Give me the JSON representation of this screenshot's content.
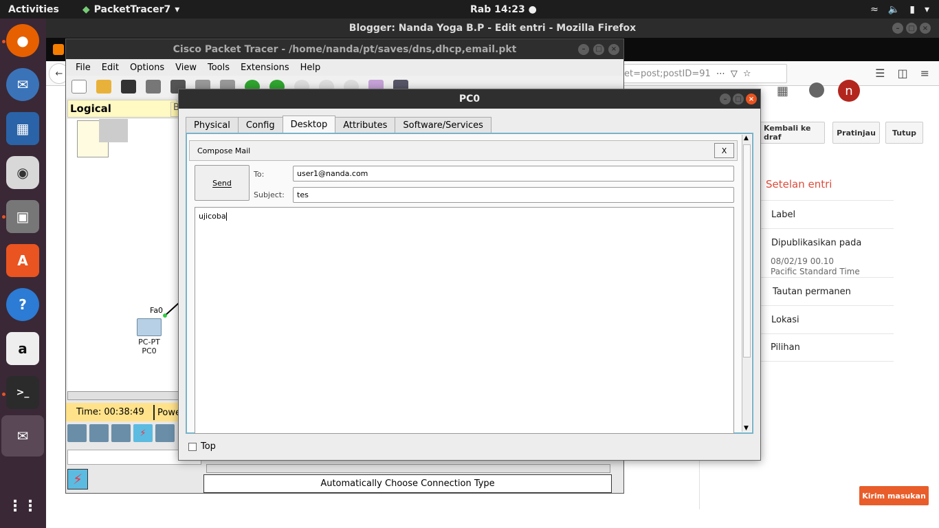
{
  "topbar": {
    "activities": "Activities",
    "app_name": "PacketTracer7",
    "clock": "Rab 14:23"
  },
  "dock": {
    "items": [
      "firefox-icon",
      "thunderbird-icon",
      "libreoffice-impress-icon",
      "rhythmbox-icon",
      "files-icon",
      "ubuntu-software-icon",
      "help-icon",
      "amazon-icon",
      "terminal-icon",
      "packet-tracer-icon",
      "show-apps-icon"
    ]
  },
  "firefox": {
    "title": "Blogger: Nanda Yoga B.P - Edit entri - Mozilla Firefox",
    "url_fragment": "et=post;postID=91",
    "avatar_letter": "n",
    "buttons": {
      "revert": "Kembali ke draf",
      "preview": "Pratinjau",
      "close": "Tutup",
      "publish": "Kirim masukan"
    },
    "sidebar": {
      "title": "Setelan entri",
      "label": "Label",
      "published_on": "Dipublikasikan pada",
      "published_date": "08/02/19 00.10",
      "timezone": "Pacific Standard Time",
      "permalink": "Tautan permanen",
      "location": "Lokasi",
      "options": "Pilihan"
    }
  },
  "packet_tracer": {
    "title": "Cisco Packet Tracer - /home/nanda/pt/saves/dns,dhcp,email.pkt",
    "menu": [
      "File",
      "Edit",
      "Options",
      "View",
      "Tools",
      "Extensions",
      "Help"
    ],
    "logical_tab": "Logical",
    "ba_tab": "Ba",
    "time": "Time: 00:38:49",
    "power_tab": "Powe",
    "node": {
      "interface": "Fa0",
      "type": "PC-PT",
      "name": "PC0"
    },
    "connection_type": "Automatically Choose Connection Type"
  },
  "pc0_dialog": {
    "title": "PC0",
    "tabs": [
      "Physical",
      "Config",
      "Desktop",
      "Attributes",
      "Software/Services"
    ],
    "active_tab": "Desktop",
    "compose": {
      "header": "Compose Mail",
      "close": "X",
      "send": "Send",
      "to_label": "To:",
      "to_value": "user1@nanda.com",
      "subject_label": "Subject:",
      "subject_value": "tes",
      "body": "ujicoba"
    },
    "top_checkbox": "Top"
  },
  "colors": {
    "ubuntu_orange": "#e95420",
    "blogger_red": "#dd4b39",
    "dock_bg": "#3a2836"
  }
}
